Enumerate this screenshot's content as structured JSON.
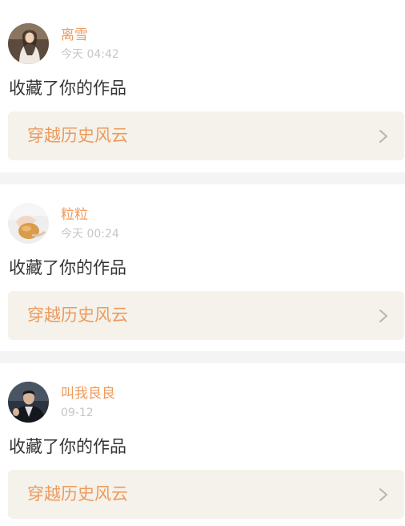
{
  "notifications": [
    {
      "username": "离雪",
      "time": "今天 04:42",
      "action": "收藏了你的作品",
      "work_title": "穿越历史风云"
    },
    {
      "username": "粒粒",
      "time": "今天 00:24",
      "action": "收藏了你的作品",
      "work_title": "穿越历史风云"
    },
    {
      "username": "叫我良良",
      "time": "09-12",
      "action": "收藏了你的作品",
      "work_title": "穿越历史风云"
    }
  ],
  "colors": {
    "accent": "#ee9a5c",
    "timestamp": "#c6c6c6",
    "body_text": "#333333",
    "link_bg": "#f4f2ea",
    "separator": "#f4f4f4",
    "chevron": "#b5b5b5"
  },
  "icons": {
    "link_arrow": "chevron-right-icon"
  }
}
